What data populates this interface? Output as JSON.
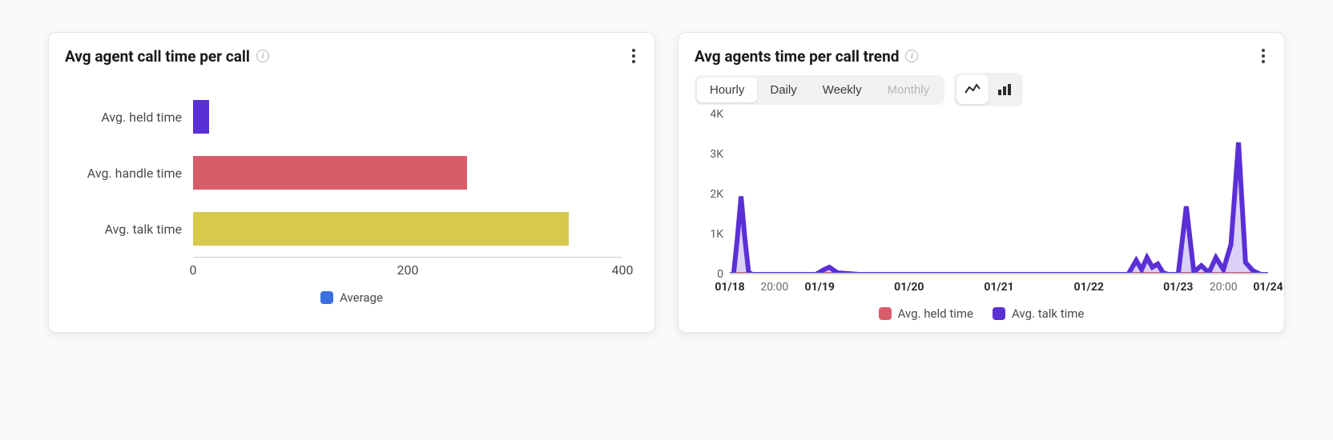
{
  "cards": {
    "bar": {
      "title": "Avg agent call time per call",
      "menu_name": "card-menu",
      "legend_label": "Average",
      "legend_swatch_color": "#3b6fe0"
    },
    "trend": {
      "title": "Avg agents time per call trend",
      "menu_name": "card-menu"
    }
  },
  "toolbar": {
    "granularity": {
      "options": [
        "Hourly",
        "Daily",
        "Weekly",
        "Monthly"
      ],
      "active": "Hourly",
      "disabled": [
        "Monthly"
      ]
    },
    "chart_type": {
      "options": [
        "line",
        "bar"
      ],
      "active": "line"
    }
  },
  "colors": {
    "purple": "#5b2fd6",
    "rose": "#d95c6a",
    "mustard": "#d6c94c",
    "blue": "#3b6fe0"
  },
  "legend_trend": [
    {
      "label": "Avg. held time",
      "color": "#d95c6a"
    },
    {
      "label": "Avg. talk time",
      "color": "#5b2fd6"
    }
  ],
  "chart_data": [
    {
      "id": "avg_agent_call_time",
      "type": "bar",
      "orientation": "horizontal",
      "title": "Avg agent call time per call",
      "categories": [
        "Avg. held time",
        "Avg. handle time",
        "Avg. talk time"
      ],
      "values": [
        15,
        255,
        350
      ],
      "bar_colors": [
        "#5b2fd6",
        "#d95c6a",
        "#d6c94c"
      ],
      "xlabel": "",
      "ylabel": "",
      "xlim": [
        0,
        400
      ],
      "x_ticks": [
        0,
        200,
        400
      ],
      "legend": [
        {
          "label": "Average",
          "color": "#3b6fe0"
        }
      ]
    },
    {
      "id": "avg_agents_time_trend",
      "type": "line",
      "title": "Avg agents time per call trend",
      "ylim": [
        0,
        4000
      ],
      "y_ticks": [
        "0",
        "1K",
        "2K",
        "3K",
        "4K"
      ],
      "x_tick_labels": [
        "01/18",
        "20:00",
        "01/19",
        "01/20",
        "01/21",
        "01/22",
        "01/23",
        "20:00",
        "01/24"
      ],
      "x_tick_major": [
        true,
        false,
        true,
        true,
        true,
        true,
        true,
        false,
        true
      ],
      "x_tick_pos": [
        0.0,
        0.083,
        0.167,
        0.333,
        0.5,
        0.667,
        0.833,
        0.917,
        1.0
      ],
      "series": [
        {
          "name": "Avg. held time",
          "color": "#d95c6a",
          "points": [
            {
              "x": 0.0,
              "y": 0
            },
            {
              "x": 0.007,
              "y": 0
            },
            {
              "x": 0.014,
              "y": 0
            },
            {
              "x": 0.021,
              "y": 0
            },
            {
              "x": 0.028,
              "y": 0
            },
            {
              "x": 0.035,
              "y": 0
            },
            {
              "x": 0.042,
              "y": 0
            },
            {
              "x": 0.049,
              "y": 0
            },
            {
              "x": 0.056,
              "y": 0
            },
            {
              "x": 0.063,
              "y": 0
            },
            {
              "x": 0.069,
              "y": 0
            },
            {
              "x": 0.076,
              "y": 0
            },
            {
              "x": 0.083,
              "y": 0
            },
            {
              "x": 0.09,
              "y": 0
            },
            {
              "x": 0.097,
              "y": 0
            },
            {
              "x": 0.104,
              "y": 0
            },
            {
              "x": 0.111,
              "y": 0
            },
            {
              "x": 0.118,
              "y": 0
            },
            {
              "x": 0.125,
              "y": 0
            },
            {
              "x": 0.132,
              "y": 0
            },
            {
              "x": 0.139,
              "y": 0
            },
            {
              "x": 0.146,
              "y": 0
            },
            {
              "x": 0.153,
              "y": 0
            },
            {
              "x": 0.16,
              "y": 0
            },
            {
              "x": 0.167,
              "y": 0
            },
            {
              "x": 0.2,
              "y": 0
            },
            {
              "x": 0.4,
              "y": 0
            },
            {
              "x": 0.6,
              "y": 0
            },
            {
              "x": 0.7,
              "y": 0
            },
            {
              "x": 0.74,
              "y": 0
            },
            {
              "x": 0.76,
              "y": 0
            },
            {
              "x": 0.78,
              "y": 0
            },
            {
              "x": 0.8,
              "y": 0
            },
            {
              "x": 0.82,
              "y": 0
            },
            {
              "x": 0.84,
              "y": 0
            },
            {
              "x": 0.86,
              "y": 0
            },
            {
              "x": 0.88,
              "y": 0
            },
            {
              "x": 0.9,
              "y": 0
            },
            {
              "x": 0.92,
              "y": 0
            },
            {
              "x": 0.94,
              "y": 0
            },
            {
              "x": 0.96,
              "y": 0
            },
            {
              "x": 0.98,
              "y": 0
            },
            {
              "x": 1.0,
              "y": 0
            }
          ]
        },
        {
          "name": "Avg. talk time",
          "color": "#5b2fd6",
          "points": [
            {
              "x": 0.0,
              "y": 0
            },
            {
              "x": 0.007,
              "y": 0
            },
            {
              "x": 0.014,
              "y": 900
            },
            {
              "x": 0.021,
              "y": 1950
            },
            {
              "x": 0.028,
              "y": 900
            },
            {
              "x": 0.035,
              "y": 50
            },
            {
              "x": 0.042,
              "y": 0
            },
            {
              "x": 0.08,
              "y": 0
            },
            {
              "x": 0.12,
              "y": 0
            },
            {
              "x": 0.16,
              "y": 0
            },
            {
              "x": 0.175,
              "y": 120
            },
            {
              "x": 0.185,
              "y": 180
            },
            {
              "x": 0.2,
              "y": 40
            },
            {
              "x": 0.24,
              "y": 0
            },
            {
              "x": 0.3,
              "y": 0
            },
            {
              "x": 0.4,
              "y": 0
            },
            {
              "x": 0.5,
              "y": 0
            },
            {
              "x": 0.6,
              "y": 0
            },
            {
              "x": 0.68,
              "y": 0
            },
            {
              "x": 0.72,
              "y": 0
            },
            {
              "x": 0.74,
              "y": 0
            },
            {
              "x": 0.755,
              "y": 350
            },
            {
              "x": 0.765,
              "y": 120
            },
            {
              "x": 0.775,
              "y": 420
            },
            {
              "x": 0.785,
              "y": 180
            },
            {
              "x": 0.795,
              "y": 260
            },
            {
              "x": 0.805,
              "y": 40
            },
            {
              "x": 0.815,
              "y": 0
            },
            {
              "x": 0.833,
              "y": 0
            },
            {
              "x": 0.848,
              "y": 1700
            },
            {
              "x": 0.862,
              "y": 60
            },
            {
              "x": 0.876,
              "y": 220
            },
            {
              "x": 0.89,
              "y": 40
            },
            {
              "x": 0.903,
              "y": 420
            },
            {
              "x": 0.917,
              "y": 120
            },
            {
              "x": 0.931,
              "y": 750
            },
            {
              "x": 0.945,
              "y": 3300
            },
            {
              "x": 0.958,
              "y": 300
            },
            {
              "x": 0.972,
              "y": 90
            },
            {
              "x": 0.986,
              "y": 0
            },
            {
              "x": 1.0,
              "y": 0
            }
          ]
        }
      ]
    }
  ]
}
